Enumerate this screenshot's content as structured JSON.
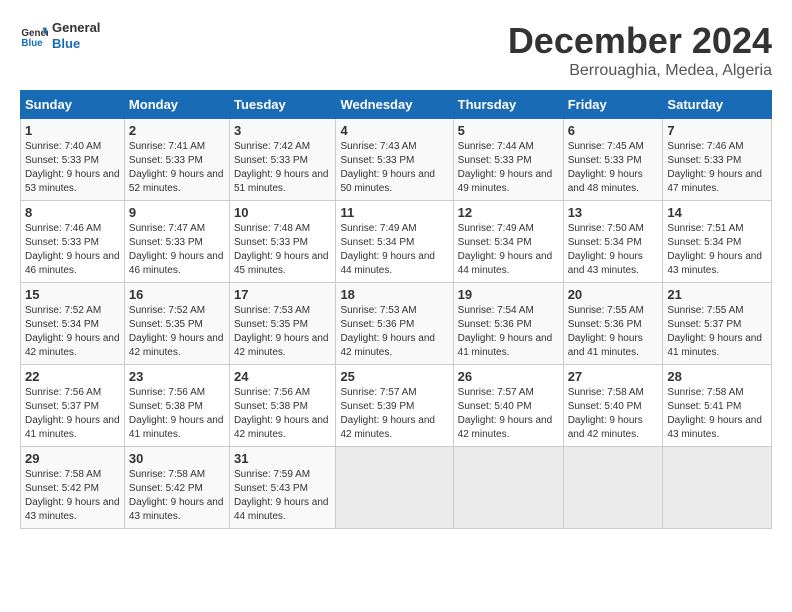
{
  "logo": {
    "text_general": "General",
    "text_blue": "Blue"
  },
  "title": "December 2024",
  "subtitle": "Berrouaghia, Medea, Algeria",
  "weekdays": [
    "Sunday",
    "Monday",
    "Tuesday",
    "Wednesday",
    "Thursday",
    "Friday",
    "Saturday"
  ],
  "weeks": [
    [
      {
        "day": "1",
        "sunrise": "7:40 AM",
        "sunset": "5:33 PM",
        "daylight": "9 hours and 53 minutes."
      },
      {
        "day": "2",
        "sunrise": "7:41 AM",
        "sunset": "5:33 PM",
        "daylight": "9 hours and 52 minutes."
      },
      {
        "day": "3",
        "sunrise": "7:42 AM",
        "sunset": "5:33 PM",
        "daylight": "9 hours and 51 minutes."
      },
      {
        "day": "4",
        "sunrise": "7:43 AM",
        "sunset": "5:33 PM",
        "daylight": "9 hours and 50 minutes."
      },
      {
        "day": "5",
        "sunrise": "7:44 AM",
        "sunset": "5:33 PM",
        "daylight": "9 hours and 49 minutes."
      },
      {
        "day": "6",
        "sunrise": "7:45 AM",
        "sunset": "5:33 PM",
        "daylight": "9 hours and 48 minutes."
      },
      {
        "day": "7",
        "sunrise": "7:46 AM",
        "sunset": "5:33 PM",
        "daylight": "9 hours and 47 minutes."
      }
    ],
    [
      {
        "day": "8",
        "sunrise": "7:46 AM",
        "sunset": "5:33 PM",
        "daylight": "9 hours and 46 minutes."
      },
      {
        "day": "9",
        "sunrise": "7:47 AM",
        "sunset": "5:33 PM",
        "daylight": "9 hours and 46 minutes."
      },
      {
        "day": "10",
        "sunrise": "7:48 AM",
        "sunset": "5:33 PM",
        "daylight": "9 hours and 45 minutes."
      },
      {
        "day": "11",
        "sunrise": "7:49 AM",
        "sunset": "5:34 PM",
        "daylight": "9 hours and 44 minutes."
      },
      {
        "day": "12",
        "sunrise": "7:49 AM",
        "sunset": "5:34 PM",
        "daylight": "9 hours and 44 minutes."
      },
      {
        "day": "13",
        "sunrise": "7:50 AM",
        "sunset": "5:34 PM",
        "daylight": "9 hours and 43 minutes."
      },
      {
        "day": "14",
        "sunrise": "7:51 AM",
        "sunset": "5:34 PM",
        "daylight": "9 hours and 43 minutes."
      }
    ],
    [
      {
        "day": "15",
        "sunrise": "7:52 AM",
        "sunset": "5:34 PM",
        "daylight": "9 hours and 42 minutes."
      },
      {
        "day": "16",
        "sunrise": "7:52 AM",
        "sunset": "5:35 PM",
        "daylight": "9 hours and 42 minutes."
      },
      {
        "day": "17",
        "sunrise": "7:53 AM",
        "sunset": "5:35 PM",
        "daylight": "9 hours and 42 minutes."
      },
      {
        "day": "18",
        "sunrise": "7:53 AM",
        "sunset": "5:36 PM",
        "daylight": "9 hours and 42 minutes."
      },
      {
        "day": "19",
        "sunrise": "7:54 AM",
        "sunset": "5:36 PM",
        "daylight": "9 hours and 41 minutes."
      },
      {
        "day": "20",
        "sunrise": "7:55 AM",
        "sunset": "5:36 PM",
        "daylight": "9 hours and 41 minutes."
      },
      {
        "day": "21",
        "sunrise": "7:55 AM",
        "sunset": "5:37 PM",
        "daylight": "9 hours and 41 minutes."
      }
    ],
    [
      {
        "day": "22",
        "sunrise": "7:56 AM",
        "sunset": "5:37 PM",
        "daylight": "9 hours and 41 minutes."
      },
      {
        "day": "23",
        "sunrise": "7:56 AM",
        "sunset": "5:38 PM",
        "daylight": "9 hours and 41 minutes."
      },
      {
        "day": "24",
        "sunrise": "7:56 AM",
        "sunset": "5:38 PM",
        "daylight": "9 hours and 42 minutes."
      },
      {
        "day": "25",
        "sunrise": "7:57 AM",
        "sunset": "5:39 PM",
        "daylight": "9 hours and 42 minutes."
      },
      {
        "day": "26",
        "sunrise": "7:57 AM",
        "sunset": "5:40 PM",
        "daylight": "9 hours and 42 minutes."
      },
      {
        "day": "27",
        "sunrise": "7:58 AM",
        "sunset": "5:40 PM",
        "daylight": "9 hours and 42 minutes."
      },
      {
        "day": "28",
        "sunrise": "7:58 AM",
        "sunset": "5:41 PM",
        "daylight": "9 hours and 43 minutes."
      }
    ],
    [
      {
        "day": "29",
        "sunrise": "7:58 AM",
        "sunset": "5:42 PM",
        "daylight": "9 hours and 43 minutes."
      },
      {
        "day": "30",
        "sunrise": "7:58 AM",
        "sunset": "5:42 PM",
        "daylight": "9 hours and 43 minutes."
      },
      {
        "day": "31",
        "sunrise": "7:59 AM",
        "sunset": "5:43 PM",
        "daylight": "9 hours and 44 minutes."
      },
      null,
      null,
      null,
      null
    ]
  ],
  "labels": {
    "sunrise": "Sunrise:",
    "sunset": "Sunset:",
    "daylight": "Daylight:"
  }
}
